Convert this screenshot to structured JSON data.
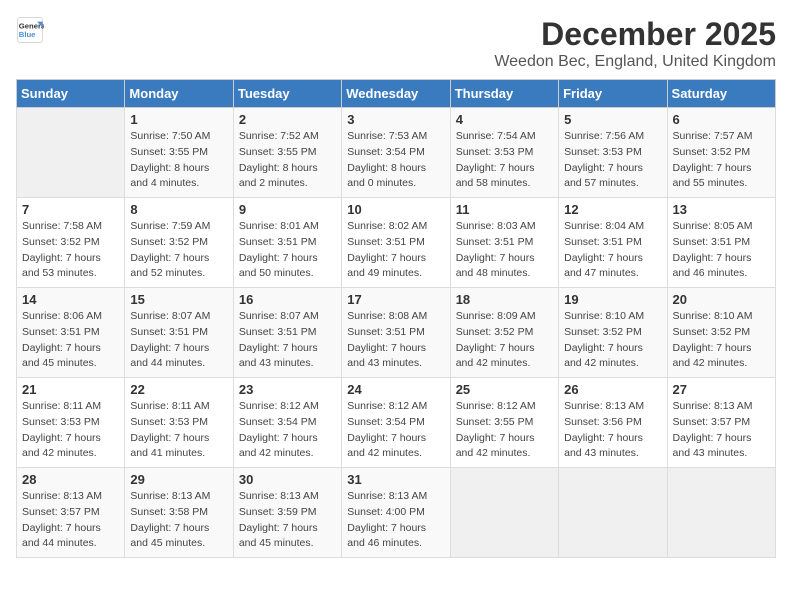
{
  "header": {
    "logo_line1": "General",
    "logo_line2": "Blue",
    "title": "December 2025",
    "subtitle": "Weedon Bec, England, United Kingdom"
  },
  "calendar": {
    "days_of_week": [
      "Sunday",
      "Monday",
      "Tuesday",
      "Wednesday",
      "Thursday",
      "Friday",
      "Saturday"
    ],
    "weeks": [
      [
        {
          "day": "",
          "info": ""
        },
        {
          "day": "1",
          "info": "Sunrise: 7:50 AM\nSunset: 3:55 PM\nDaylight: 8 hours\nand 4 minutes."
        },
        {
          "day": "2",
          "info": "Sunrise: 7:52 AM\nSunset: 3:55 PM\nDaylight: 8 hours\nand 2 minutes."
        },
        {
          "day": "3",
          "info": "Sunrise: 7:53 AM\nSunset: 3:54 PM\nDaylight: 8 hours\nand 0 minutes."
        },
        {
          "day": "4",
          "info": "Sunrise: 7:54 AM\nSunset: 3:53 PM\nDaylight: 7 hours\nand 58 minutes."
        },
        {
          "day": "5",
          "info": "Sunrise: 7:56 AM\nSunset: 3:53 PM\nDaylight: 7 hours\nand 57 minutes."
        },
        {
          "day": "6",
          "info": "Sunrise: 7:57 AM\nSunset: 3:52 PM\nDaylight: 7 hours\nand 55 minutes."
        }
      ],
      [
        {
          "day": "7",
          "info": "Sunrise: 7:58 AM\nSunset: 3:52 PM\nDaylight: 7 hours\nand 53 minutes."
        },
        {
          "day": "8",
          "info": "Sunrise: 7:59 AM\nSunset: 3:52 PM\nDaylight: 7 hours\nand 52 minutes."
        },
        {
          "day": "9",
          "info": "Sunrise: 8:01 AM\nSunset: 3:51 PM\nDaylight: 7 hours\nand 50 minutes."
        },
        {
          "day": "10",
          "info": "Sunrise: 8:02 AM\nSunset: 3:51 PM\nDaylight: 7 hours\nand 49 minutes."
        },
        {
          "day": "11",
          "info": "Sunrise: 8:03 AM\nSunset: 3:51 PM\nDaylight: 7 hours\nand 48 minutes."
        },
        {
          "day": "12",
          "info": "Sunrise: 8:04 AM\nSunset: 3:51 PM\nDaylight: 7 hours\nand 47 minutes."
        },
        {
          "day": "13",
          "info": "Sunrise: 8:05 AM\nSunset: 3:51 PM\nDaylight: 7 hours\nand 46 minutes."
        }
      ],
      [
        {
          "day": "14",
          "info": "Sunrise: 8:06 AM\nSunset: 3:51 PM\nDaylight: 7 hours\nand 45 minutes."
        },
        {
          "day": "15",
          "info": "Sunrise: 8:07 AM\nSunset: 3:51 PM\nDaylight: 7 hours\nand 44 minutes."
        },
        {
          "day": "16",
          "info": "Sunrise: 8:07 AM\nSunset: 3:51 PM\nDaylight: 7 hours\nand 43 minutes."
        },
        {
          "day": "17",
          "info": "Sunrise: 8:08 AM\nSunset: 3:51 PM\nDaylight: 7 hours\nand 43 minutes."
        },
        {
          "day": "18",
          "info": "Sunrise: 8:09 AM\nSunset: 3:52 PM\nDaylight: 7 hours\nand 42 minutes."
        },
        {
          "day": "19",
          "info": "Sunrise: 8:10 AM\nSunset: 3:52 PM\nDaylight: 7 hours\nand 42 minutes."
        },
        {
          "day": "20",
          "info": "Sunrise: 8:10 AM\nSunset: 3:52 PM\nDaylight: 7 hours\nand 42 minutes."
        }
      ],
      [
        {
          "day": "21",
          "info": "Sunrise: 8:11 AM\nSunset: 3:53 PM\nDaylight: 7 hours\nand 42 minutes."
        },
        {
          "day": "22",
          "info": "Sunrise: 8:11 AM\nSunset: 3:53 PM\nDaylight: 7 hours\nand 41 minutes."
        },
        {
          "day": "23",
          "info": "Sunrise: 8:12 AM\nSunset: 3:54 PM\nDaylight: 7 hours\nand 42 minutes."
        },
        {
          "day": "24",
          "info": "Sunrise: 8:12 AM\nSunset: 3:54 PM\nDaylight: 7 hours\nand 42 minutes."
        },
        {
          "day": "25",
          "info": "Sunrise: 8:12 AM\nSunset: 3:55 PM\nDaylight: 7 hours\nand 42 minutes."
        },
        {
          "day": "26",
          "info": "Sunrise: 8:13 AM\nSunset: 3:56 PM\nDaylight: 7 hours\nand 43 minutes."
        },
        {
          "day": "27",
          "info": "Sunrise: 8:13 AM\nSunset: 3:57 PM\nDaylight: 7 hours\nand 43 minutes."
        }
      ],
      [
        {
          "day": "28",
          "info": "Sunrise: 8:13 AM\nSunset: 3:57 PM\nDaylight: 7 hours\nand 44 minutes."
        },
        {
          "day": "29",
          "info": "Sunrise: 8:13 AM\nSunset: 3:58 PM\nDaylight: 7 hours\nand 45 minutes."
        },
        {
          "day": "30",
          "info": "Sunrise: 8:13 AM\nSunset: 3:59 PM\nDaylight: 7 hours\nand 45 minutes."
        },
        {
          "day": "31",
          "info": "Sunrise: 8:13 AM\nSunset: 4:00 PM\nDaylight: 7 hours\nand 46 minutes."
        },
        {
          "day": "",
          "info": ""
        },
        {
          "day": "",
          "info": ""
        },
        {
          "day": "",
          "info": ""
        }
      ]
    ]
  }
}
